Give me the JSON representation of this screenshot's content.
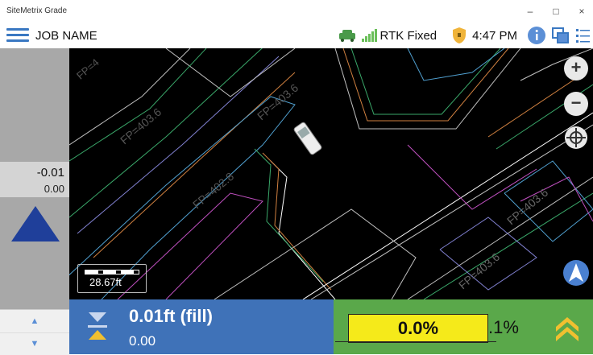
{
  "app": {
    "title": "SiteMetrix Grade"
  },
  "window": {
    "minimize": "–",
    "maximize": "□",
    "close": "×"
  },
  "toolbar": {
    "job_name": "JOB NAME",
    "gps_status": "RTK Fixed",
    "time": "4:47 PM"
  },
  "side_panel": {
    "value_top": "-0.01",
    "value_bottom": "0.00",
    "stepper_up": "▲",
    "stepper_down": "▼"
  },
  "map": {
    "scale": "28.67ft",
    "labels": [
      "FP=4",
      "FP=403.6",
      "FP=402.8",
      "FP=403.6",
      "FP=403.6",
      "FP=403.6"
    ],
    "zoom_in": "+",
    "zoom_out": "−"
  },
  "fill": {
    "main": "0.01ft (fill)",
    "sub": "0.00"
  },
  "slope": {
    "primary": "0.0%",
    "secondary": ".1%"
  },
  "colors": {
    "fill_panel": "#3f72b8",
    "slope_panel": "#5aa84a",
    "slope_box": "#f5ea1a",
    "indicator": "#1f3f9a"
  }
}
